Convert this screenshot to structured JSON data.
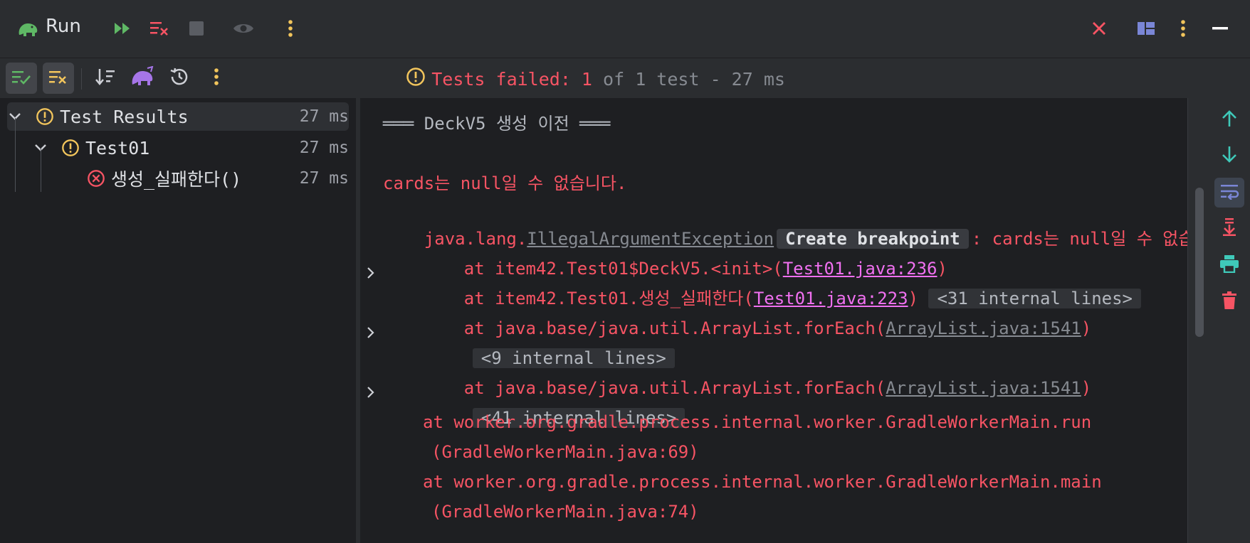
{
  "titlebar": {
    "title": "Run",
    "icons": [
      "gradle-elephant-icon",
      "rerun-icon",
      "rerun-failed-icon",
      "stop-icon",
      "eye-icon",
      "more-vertical-icon",
      "close-icon",
      "layout-icon",
      "more-vertical-icon",
      "minimize-icon"
    ]
  },
  "toolbar": {
    "icons": [
      "show-passed-icon",
      "show-ignored-icon",
      "sort-icon",
      "gradle-icon",
      "history-icon",
      "more-vertical-icon"
    ]
  },
  "status": {
    "prefix": "Tests failed: 1",
    "suffix": " of 1 test - 27 ms"
  },
  "tree": {
    "root": {
      "label": "Test Results",
      "time": "27 ms"
    },
    "class": {
      "label": "Test01",
      "time": "27 ms"
    },
    "method": {
      "label": "생성_실패한다()",
      "time": "27 ms"
    }
  },
  "console": {
    "header": "═══ DeckV5 생성 이전 ═══",
    "message": "cards는 null일 수 없습니다.",
    "exception_prefix": "java.lang.",
    "exception_class": "IllegalArgumentException",
    "breakpoint_chip": "Create breakpoint",
    "exception_suffix": ": cards는 null일 수 없습니다.",
    "frames": {
      "f1_text": "at item42.Test01$DeckV5.<init>(",
      "f1_link": "Test01.java:236",
      "f2_text": "at item42.Test01.생성_실패한다(",
      "f2_link": "Test01.java:223",
      "f2_fold": "<31 internal lines>",
      "f3_text": "at java.base/java.util.ArrayList.forEach(",
      "f3_link": "ArrayList.java:1541",
      "fold2": "<9 internal lines>",
      "f4_text": "at java.base/java.util.ArrayList.forEach(",
      "f4_link": "ArrayList.java:1541",
      "fold3": "<41 internal lines>",
      "f5_text": "at worker.org.gradle.process.internal.worker.GradleWorkerMain.run",
      "f5_cont": "(GradleWorkerMain.java:69)",
      "f6_text": "at worker.org.gradle.process.internal.worker.GradleWorkerMain.main",
      "f6_cont": "(GradleWorkerMain.java:74)"
    },
    "close_paren": ")"
  },
  "right_strip": {
    "icons": [
      "scroll-up-icon",
      "scroll-down-icon",
      "soft-wrap-icon",
      "scroll-to-end-icon",
      "print-icon",
      "clear-all-icon"
    ]
  },
  "colors": {
    "accent_red": "#f75464",
    "warning_yellow": "#f2c55c",
    "link_magenta": "#f070f0",
    "teal": "#3fc9b9",
    "green": "#5fb865"
  }
}
